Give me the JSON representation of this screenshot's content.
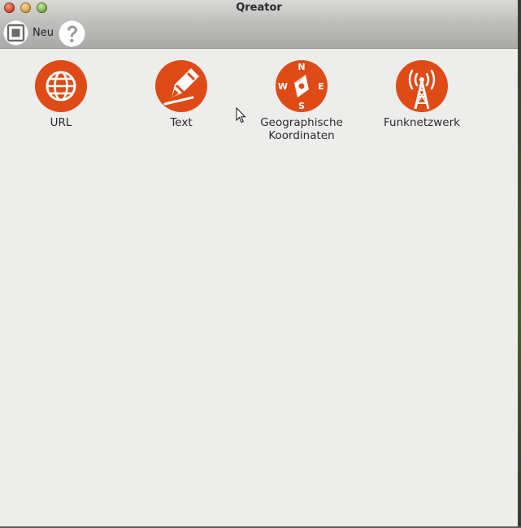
{
  "window": {
    "title": "Qreator",
    "buttons": [
      "close",
      "minimize",
      "maximize"
    ]
  },
  "toolbar": {
    "new_label": "Neu",
    "new_icon": "new-qr-icon",
    "help_icon": "help-icon"
  },
  "items": [
    {
      "id": "url",
      "label": "URL",
      "icon": "globe-icon"
    },
    {
      "id": "text",
      "label": "Text",
      "icon": "pencil-icon"
    },
    {
      "id": "geo",
      "label": "Geographische Koordinaten",
      "icon": "compass-icon"
    },
    {
      "id": "wifi",
      "label": "Funknetzwerk",
      "icon": "antenna-icon"
    }
  ],
  "compass": {
    "n": "N",
    "e": "E",
    "s": "S",
    "w": "W"
  },
  "colors": {
    "accent": "#df4b16",
    "background": "#ededec"
  }
}
